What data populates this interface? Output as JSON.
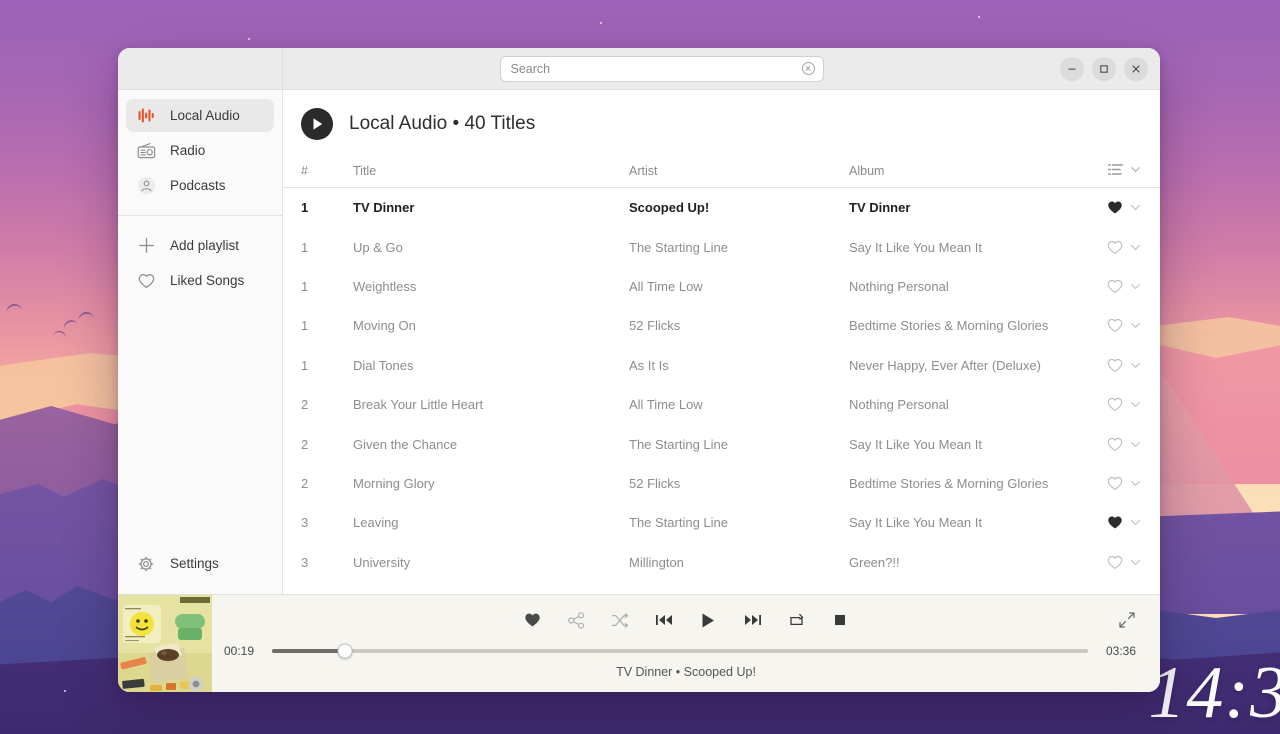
{
  "desktop": {
    "clock": "14:3"
  },
  "window": {
    "controls": {
      "minimize": "minimize",
      "maximize": "maximize",
      "close": "close"
    }
  },
  "search": {
    "value": "",
    "placeholder": "Search",
    "clear_icon": "clear-circle-icon"
  },
  "sidebar": {
    "items": [
      {
        "label": "Local Audio",
        "icon": "equalizer-icon",
        "active": true
      },
      {
        "label": "Radio",
        "icon": "radio-icon",
        "active": false
      },
      {
        "label": "Podcasts",
        "icon": "podcast-icon",
        "active": false
      },
      {
        "label": "Add playlist",
        "icon": "plus-icon",
        "active": false
      },
      {
        "label": "Liked Songs",
        "icon": "heart-icon",
        "active": false
      }
    ],
    "settings": {
      "label": "Settings",
      "icon": "gear-icon"
    }
  },
  "content": {
    "play_icon": "play-icon",
    "title": "Local Audio  •  40 Titles",
    "sort_icon": "sort-list-icon",
    "columns": {
      "num": "#",
      "title": "Title",
      "artist": "Artist",
      "album": "Album"
    },
    "tracks": [
      {
        "num": "1",
        "title": "TV Dinner",
        "artist": "Scooped Up!",
        "album": "TV Dinner",
        "liked": true,
        "current": true
      },
      {
        "num": "1",
        "title": "Up & Go",
        "artist": "The Starting Line",
        "album": "Say It Like You Mean It",
        "liked": false,
        "current": false
      },
      {
        "num": "1",
        "title": "Weightless",
        "artist": "All Time Low",
        "album": "Nothing Personal",
        "liked": false,
        "current": false
      },
      {
        "num": "1",
        "title": "Moving On",
        "artist": "52 Flicks",
        "album": "Bedtime Stories & Morning Glories",
        "liked": false,
        "current": false
      },
      {
        "num": "1",
        "title": "Dial Tones",
        "artist": "As It Is",
        "album": "Never Happy, Ever After (Deluxe)",
        "liked": false,
        "current": false
      },
      {
        "num": "2",
        "title": "Break Your Little Heart",
        "artist": "All Time Low",
        "album": "Nothing Personal",
        "liked": false,
        "current": false
      },
      {
        "num": "2",
        "title": "Given the Chance",
        "artist": "The Starting Line",
        "album": "Say It Like You Mean It",
        "liked": false,
        "current": false
      },
      {
        "num": "2",
        "title": "Morning Glory",
        "artist": "52 Flicks",
        "album": "Bedtime Stories & Morning Glories",
        "liked": false,
        "current": false
      },
      {
        "num": "3",
        "title": "Leaving",
        "artist": "The Starting Line",
        "album": "Say It Like You Mean It",
        "liked": true,
        "current": false
      },
      {
        "num": "3",
        "title": "University",
        "artist": "Millington",
        "album": "Green?!!",
        "liked": false,
        "current": false
      }
    ]
  },
  "player": {
    "album_art": "scooped-up-album-cover",
    "elapsed": "00:19",
    "duration": "03:36",
    "progress_percent": 9,
    "now_playing": "TV Dinner  •  Scooped Up!",
    "buttons": [
      {
        "name": "like-button",
        "icon": "heart-filled-icon"
      },
      {
        "name": "share-button",
        "icon": "share-icon"
      },
      {
        "name": "shuffle-button",
        "icon": "shuffle-icon"
      },
      {
        "name": "previous-button",
        "icon": "previous-icon"
      },
      {
        "name": "play-button",
        "icon": "play-icon"
      },
      {
        "name": "next-button",
        "icon": "next-icon"
      },
      {
        "name": "repeat-button",
        "icon": "repeat-icon"
      },
      {
        "name": "stop-button",
        "icon": "stop-icon"
      }
    ],
    "expand_icon": "expand-icon"
  },
  "colors": {
    "accent": "#e8542a",
    "window_bg": "#ffffff",
    "headerbar_bg": "#ebebeb",
    "sidebar_bg": "#fafafa",
    "player_bg": "#f6f5f0"
  }
}
